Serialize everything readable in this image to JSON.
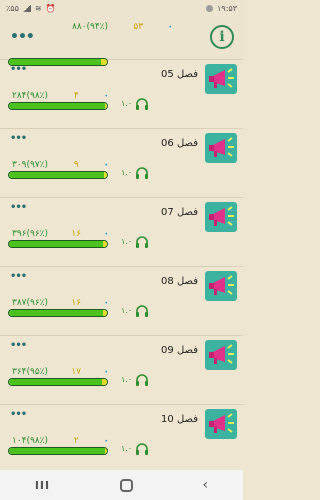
{
  "status": {
    "time": "۱۹:۵۳",
    "battery": "٪۵۵"
  },
  "header": {
    "menu": "•••",
    "total_score": "۸۸۰(۹۴٪)",
    "total_count": "۵۳",
    "dot": "•",
    "progress_percent": 94,
    "info_icon": "i"
  },
  "colors": {
    "background": "#efe6d2",
    "bar_fill": "#4cc21e",
    "bar_rest": "#e3dc2a",
    "accent": "#2a6f74"
  },
  "items": [
    {
      "title": "فصل 05",
      "score": "۲۸۴(۹۸٪)",
      "count": "۴",
      "dot": "•",
      "audio": "۱.۰",
      "progress_percent": 98
    },
    {
      "title": "فصل 06",
      "score": "۳۰۹(۹۷٪)",
      "count": "۹",
      "dot": "•",
      "audio": "۱.۰",
      "progress_percent": 97
    },
    {
      "title": "فصل 07",
      "score": "۳۹۶(۹۶٪)",
      "count": "۱۶",
      "dot": "•",
      "audio": "۱.۰",
      "progress_percent": 96
    },
    {
      "title": "فصل 08",
      "score": "۳۸۷(۹۶٪)",
      "count": "۱۶",
      "dot": "•",
      "audio": "۱.۰",
      "progress_percent": 96
    },
    {
      "title": "فصل 09",
      "score": "۳۶۴(۹۵٪)",
      "count": "۱۷",
      "dot": "•",
      "audio": "۱.۰",
      "progress_percent": 95
    },
    {
      "title": "فصل 10",
      "score": "۱۰۴(۹۸٪)",
      "count": "۲",
      "dot": "•",
      "audio": "۱.۰",
      "progress_percent": 98
    }
  ],
  "navbar": {
    "recents": "III",
    "back": "‹"
  }
}
